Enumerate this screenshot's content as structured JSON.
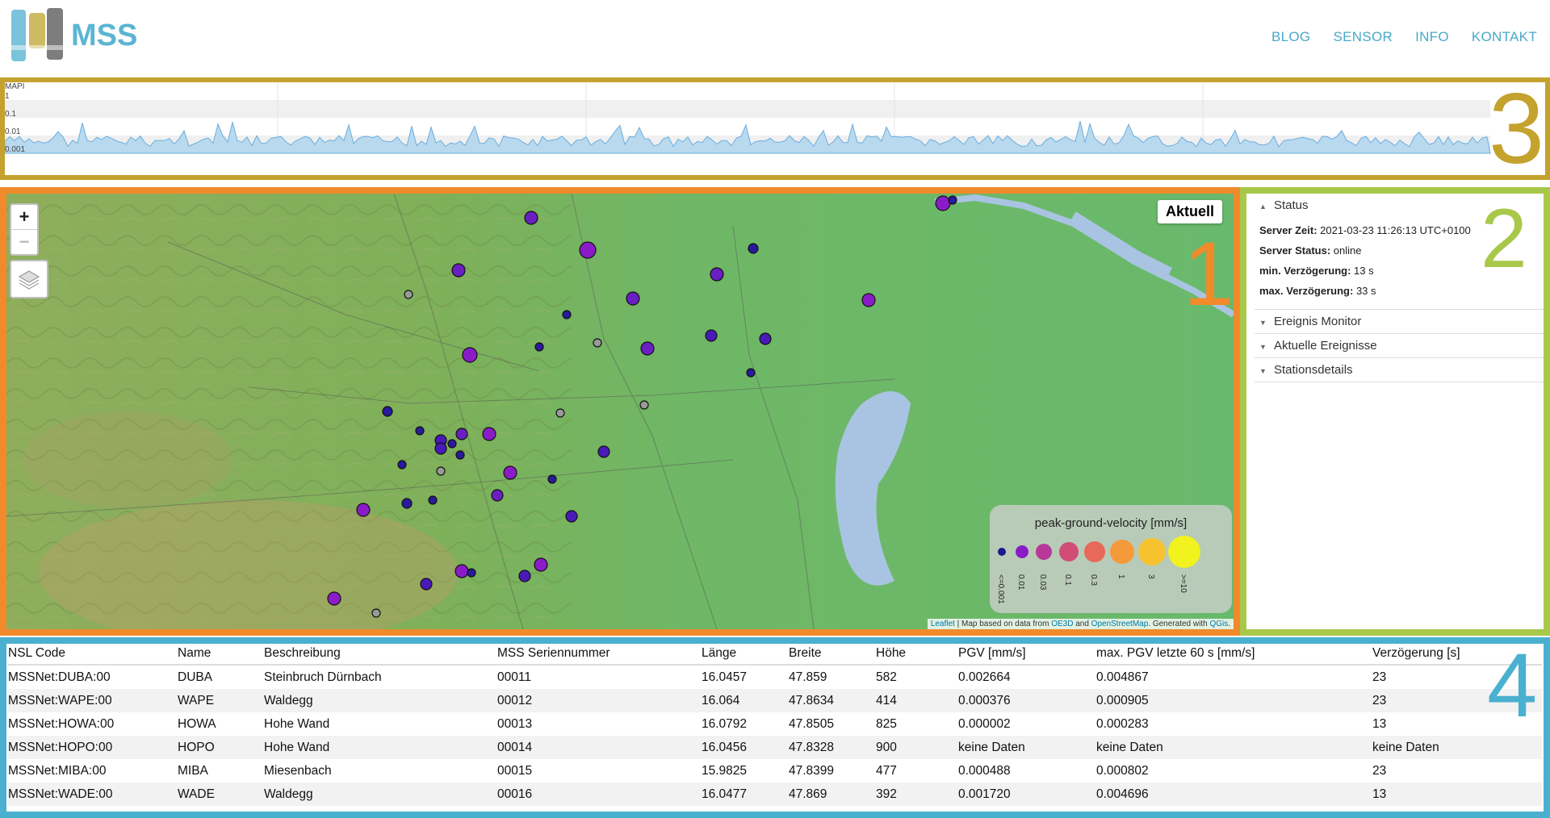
{
  "header": {
    "logo_text": "MSS",
    "nav": [
      "BLOG",
      "SENSOR",
      "INFO",
      "KONTAKT"
    ]
  },
  "sections": {
    "s1": "1",
    "s2": "2",
    "s3": "3",
    "s4": "4"
  },
  "timeline": {
    "ylabel": "MAPI",
    "ticks": [
      "1",
      "0.1",
      "0.01",
      "0.001"
    ]
  },
  "map": {
    "zoom_in": "+",
    "zoom_out": "−",
    "aktuell_button": "Aktuell",
    "legend": {
      "title": "peak-ground-velocity [mm/s]",
      "labels": [
        "<=0.001",
        "0.01",
        "0.03",
        "0.1",
        "0.3",
        "1",
        "3",
        ">=10"
      ],
      "colors": [
        "#1a1a8c",
        "#8a1cc7",
        "#b8389a",
        "#d24c78",
        "#e8685a",
        "#f59a3a",
        "#f6c22e",
        "#f2f21e"
      ]
    },
    "attribution": {
      "leaflet": "Leaflet",
      "mid": " | Map based on data from ",
      "oe3d": "OE3D",
      "and": " and ",
      "osm": "OpenStreetMap",
      "gen": ". Generated with ",
      "qgis": "QGis",
      "end": "."
    }
  },
  "sidebar": {
    "status_title": "Status",
    "server_time_label": "Server Zeit:",
    "server_time": "2021-03-23 11:26:13 UTC+0100",
    "server_status_label": "Server Status:",
    "server_status": "online",
    "min_delay_label": "min. Verzögerung:",
    "min_delay": "13 s",
    "max_delay_label": "max. Verzögerung:",
    "max_delay": "33 s",
    "items": [
      "Ereignis Monitor",
      "Aktuelle Ereignisse",
      "Stationsdetails"
    ]
  },
  "table": {
    "headers": [
      "NSL Code",
      "Name",
      "Beschreibung",
      "MSS Seriennummer",
      "Länge",
      "Breite",
      "Höhe",
      "PGV [mm/s]",
      "max. PGV letzte 60 s [mm/s]",
      "Verzögerung [s]"
    ],
    "rows": [
      [
        "MSSNet:DUBA:00",
        "DUBA",
        "Steinbruch Dürnbach",
        "00011",
        "16.0457",
        "47.859",
        "582",
        "0.002664",
        "0.004867",
        "23"
      ],
      [
        "MSSNet:WAPE:00",
        "WAPE",
        "Waldegg",
        "00012",
        "16.064",
        "47.8634",
        "414",
        "0.000376",
        "0.000905",
        "23"
      ],
      [
        "MSSNet:HOWA:00",
        "HOWA",
        "Hohe Wand",
        "00013",
        "16.0792",
        "47.8505",
        "825",
        "0.000002",
        "0.000283",
        "13"
      ],
      [
        "MSSNet:HOPO:00",
        "HOPO",
        "Hohe Wand",
        "00014",
        "16.0456",
        "47.8328",
        "900",
        "keine Daten",
        "keine Daten",
        "keine Daten"
      ],
      [
        "MSSNet:MIBA:00",
        "MIBA",
        "Miesenbach",
        "00015",
        "15.9825",
        "47.8399",
        "477",
        "0.000488",
        "0.000802",
        "23"
      ],
      [
        "MSSNet:WADE:00",
        "WADE",
        "Waldegg",
        "00016",
        "16.0477",
        "47.869",
        "392",
        "0.001720",
        "0.004696",
        "13"
      ]
    ]
  }
}
